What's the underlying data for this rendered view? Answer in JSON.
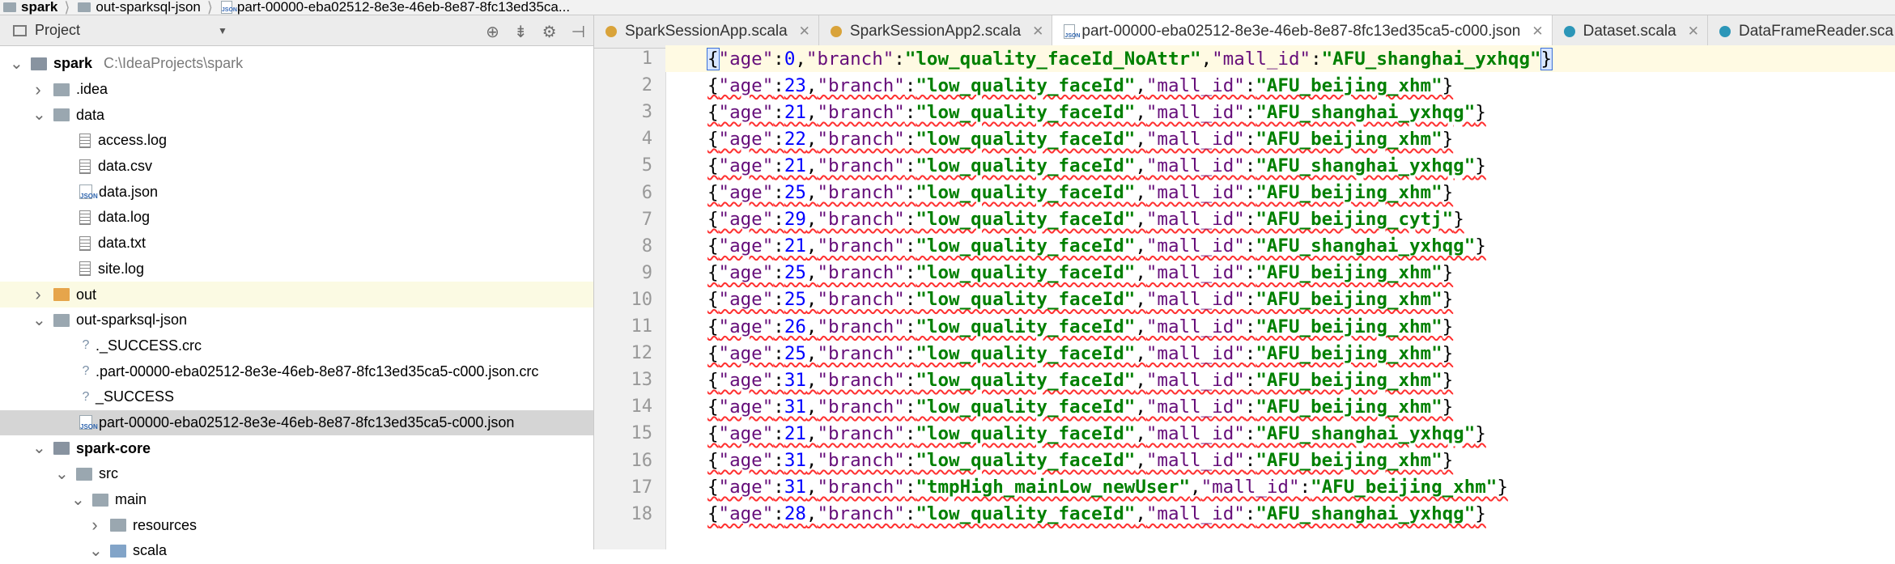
{
  "breadcrumb": [
    {
      "label": "spark"
    },
    {
      "label": "out-sparksql-json"
    },
    {
      "label": "part-00000-eba02512-8e3e-46eb-8e87-8fc13ed35ca..."
    }
  ],
  "project_panel": {
    "title": "Project",
    "dropdown_icon": "chevron-down-icon",
    "tools": [
      "globe-icon",
      "collapse-all-icon",
      "gear-icon",
      "hide-panel-icon"
    ]
  },
  "tree": [
    {
      "label": "spark",
      "path": "C:\\IdeaProjects\\spark",
      "indent": 0,
      "arrow": "down",
      "icon": "project-folder"
    },
    {
      "label": ".idea",
      "indent": 1,
      "arrow": "right",
      "icon": "folder"
    },
    {
      "label": "data",
      "indent": 1,
      "arrow": "down",
      "icon": "folder"
    },
    {
      "label": "access.log",
      "indent": 2,
      "arrow": "none",
      "icon": "text-file"
    },
    {
      "label": "data.csv",
      "indent": 2,
      "arrow": "none",
      "icon": "text-file"
    },
    {
      "label": "data.json",
      "indent": 2,
      "arrow": "none",
      "icon": "json-file"
    },
    {
      "label": "data.log",
      "indent": 2,
      "arrow": "none",
      "icon": "text-file"
    },
    {
      "label": "data.txt",
      "indent": 2,
      "arrow": "none",
      "icon": "text-file"
    },
    {
      "label": "site.log",
      "indent": 2,
      "arrow": "none",
      "icon": "text-file"
    },
    {
      "label": "out",
      "indent": 1,
      "arrow": "right",
      "icon": "orange-folder"
    },
    {
      "label": "out-sparksql-json",
      "indent": 1,
      "arrow": "down",
      "icon": "folder"
    },
    {
      "label": "._SUCCESS.crc",
      "indent": 2,
      "arrow": "none",
      "icon": "unknown-file"
    },
    {
      "label": ".part-00000-eba02512-8e3e-46eb-8e87-8fc13ed35ca5-c000.json.crc",
      "indent": 2,
      "arrow": "none",
      "icon": "unknown-file"
    },
    {
      "label": "_SUCCESS",
      "indent": 2,
      "arrow": "none",
      "icon": "unknown-file"
    },
    {
      "label": "part-00000-eba02512-8e3e-46eb-8e87-8fc13ed35ca5-c000.json",
      "indent": 2,
      "arrow": "none",
      "icon": "json-file",
      "selected": true
    },
    {
      "label": "spark-core",
      "indent": 1,
      "arrow": "down",
      "icon": "module-folder",
      "bold": true
    },
    {
      "label": "src",
      "indent": 2,
      "arrow": "down",
      "icon": "folder"
    },
    {
      "label": "main",
      "indent": 3,
      "arrow": "down",
      "icon": "folder"
    },
    {
      "label": "resources",
      "indent": 4,
      "arrow": "right",
      "icon": "resources-folder"
    },
    {
      "label": "scala",
      "indent": 4,
      "arrow": "down",
      "icon": "blue-folder"
    }
  ],
  "tabs": [
    {
      "label": "SparkSessionApp.scala",
      "icon": "scala-object-icon"
    },
    {
      "label": "SparkSessionApp2.scala",
      "icon": "scala-object-icon"
    },
    {
      "label": "part-00000-eba02512-8e3e-46eb-8e87-8fc13ed35ca5-c000.json",
      "icon": "json-file-icon",
      "active": true
    },
    {
      "label": "Dataset.scala",
      "icon": "scala-class-icon"
    },
    {
      "label": "DataFrameReader.sca",
      "icon": "scala-class-icon"
    }
  ],
  "editor": {
    "current_line": 1,
    "lines": [
      {
        "n": "1",
        "age": "0",
        "branch": "low_quality_faceId_NoAttr",
        "mall_id": "AFU_shanghai_yxhqg"
      },
      {
        "n": "2",
        "age": "23",
        "branch": "low_quality_faceId",
        "mall_id": "AFU_beijing_xhm"
      },
      {
        "n": "3",
        "age": "21",
        "branch": "low_quality_faceId",
        "mall_id": "AFU_shanghai_yxhqg"
      },
      {
        "n": "4",
        "age": "22",
        "branch": "low_quality_faceId",
        "mall_id": "AFU_beijing_xhm"
      },
      {
        "n": "5",
        "age": "21",
        "branch": "low_quality_faceId",
        "mall_id": "AFU_shanghai_yxhqg"
      },
      {
        "n": "6",
        "age": "25",
        "branch": "low_quality_faceId",
        "mall_id": "AFU_beijing_xhm"
      },
      {
        "n": "7",
        "age": "29",
        "branch": "low_quality_faceId",
        "mall_id": "AFU_beijing_cytj"
      },
      {
        "n": "8",
        "age": "21",
        "branch": "low_quality_faceId",
        "mall_id": "AFU_shanghai_yxhqg"
      },
      {
        "n": "9",
        "age": "25",
        "branch": "low_quality_faceId",
        "mall_id": "AFU_beijing_xhm"
      },
      {
        "n": "10",
        "age": "25",
        "branch": "low_quality_faceId",
        "mall_id": "AFU_beijing_xhm"
      },
      {
        "n": "11",
        "age": "26",
        "branch": "low_quality_faceId",
        "mall_id": "AFU_beijing_xhm"
      },
      {
        "n": "12",
        "age": "25",
        "branch": "low_quality_faceId",
        "mall_id": "AFU_beijing_xhm"
      },
      {
        "n": "13",
        "age": "31",
        "branch": "low_quality_faceId",
        "mall_id": "AFU_beijing_xhm"
      },
      {
        "n": "14",
        "age": "31",
        "branch": "low_quality_faceId",
        "mall_id": "AFU_beijing_xhm"
      },
      {
        "n": "15",
        "age": "21",
        "branch": "low_quality_faceId",
        "mall_id": "AFU_shanghai_yxhqg"
      },
      {
        "n": "16",
        "age": "31",
        "branch": "low_quality_faceId",
        "mall_id": "AFU_beijing_xhm"
      },
      {
        "n": "17",
        "age": "31",
        "branch": "tmpHigh_mainLow_newUser",
        "mall_id": "AFU_beijing_xhm"
      },
      {
        "n": "18",
        "age": "28",
        "branch": "low_quality_faceId",
        "mall_id": "AFU_shanghai_yxhqg"
      }
    ]
  },
  "colors": {
    "key": "#660e7a",
    "string": "#008000",
    "number": "#0000ff",
    "selection": "#d5d5d5",
    "current_line": "#fffae3"
  }
}
